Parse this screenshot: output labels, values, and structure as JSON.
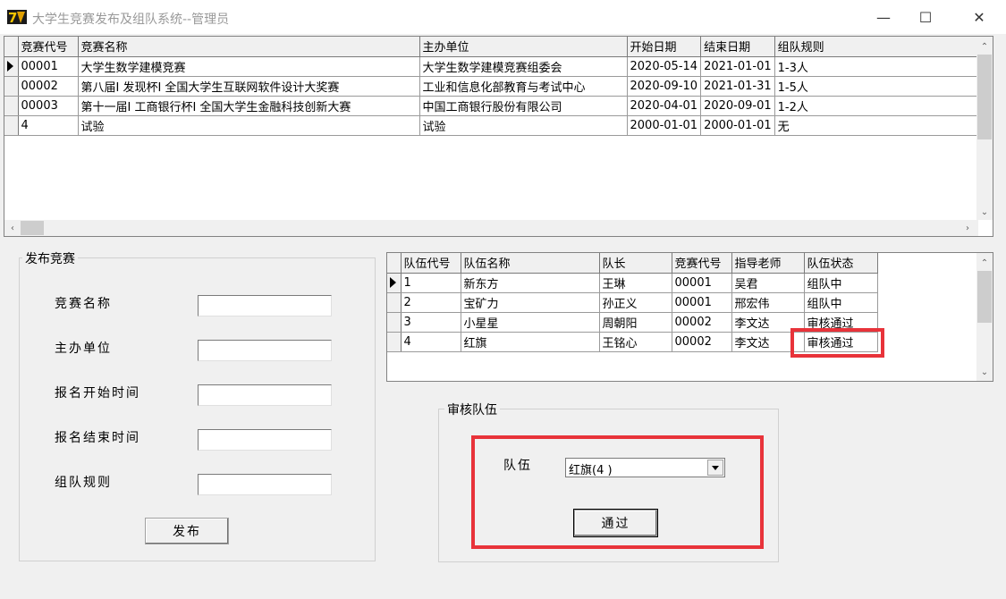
{
  "window": {
    "title": "大学生竞赛发布及组队系统--管理员",
    "minimize": "—",
    "maximize": "☐",
    "close": "✕"
  },
  "competition_grid": {
    "columns": [
      "竞赛代号",
      "竞赛名称",
      "主办单位",
      "开始日期",
      "结束日期",
      "组队规则"
    ],
    "rows": [
      [
        "00001",
        "大学生数学建模竞赛",
        "大学生数学建模竞赛组委会",
        "2020-05-14",
        "2021-01-01",
        "1-3人"
      ],
      [
        "00002",
        "第八届I 发现杯I 全国大学生互联网软件设计大奖赛",
        "工业和信息化部教育与考试中心",
        "2020-09-10",
        "2021-01-31",
        "1-5人"
      ],
      [
        "00003",
        "第十一届I 工商银行杯I 全国大学生金融科技创新大赛",
        "中国工商银行股份有限公司",
        "2020-04-01",
        "2020-09-01",
        "1-2人"
      ],
      [
        "4",
        "试验",
        "试验",
        "2000-01-01",
        "2000-01-01",
        "无"
      ]
    ],
    "current_row": 0
  },
  "publish": {
    "group_label": "发布竞赛",
    "name_label": "竞赛名称",
    "host_label": "主办单位",
    "start_label": "报名开始时间",
    "end_label": "报名结束时间",
    "rule_label": "组队规则",
    "name_value": "",
    "host_value": "",
    "start_value": "",
    "end_value": "",
    "rule_value": "",
    "submit_label": "发布"
  },
  "team_grid": {
    "columns": [
      "队伍代号",
      "队伍名称",
      "队长",
      "竞赛代号",
      "指导老师",
      "队伍状态"
    ],
    "rows": [
      [
        "1",
        "新东方",
        "王琳",
        "00001",
        "吴君",
        "组队中"
      ],
      [
        "2",
        "宝矿力",
        "孙正义",
        "00001",
        "邢宏伟",
        "组队中"
      ],
      [
        "3",
        "小星星",
        "周朝阳",
        "00002",
        "李文达",
        "审核通过"
      ],
      [
        "4",
        "红旗",
        "王铭心",
        "00002",
        "李文达",
        "审核通过"
      ]
    ],
    "current_row": 0
  },
  "review": {
    "group_label": "审核队伍",
    "team_label": "队伍",
    "team_selected": "红旗(4   )",
    "approve_label": "通过"
  },
  "colors": {
    "highlight": "#e8333a",
    "grid_bg": "#ffffff",
    "window_bg": "#f0f0f0"
  }
}
